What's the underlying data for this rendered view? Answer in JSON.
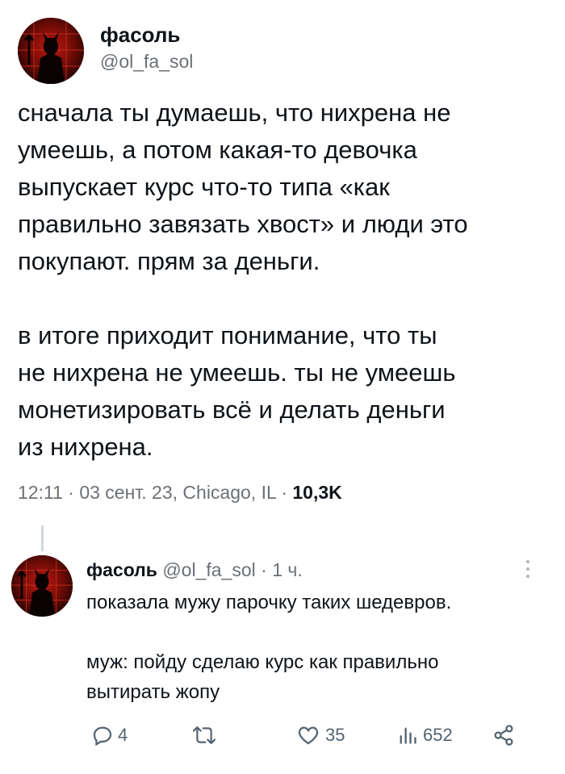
{
  "main_tweet": {
    "author_name": "фасоль",
    "author_handle": "@ol_fa_sol",
    "paragraphs": [
      "сначала ты думаешь, что нихрена не\nумеешь, а потом какая-то девочка\nвыпускает курс что-то типа «как\nправильно завязать хвост» и люди это\nпокупают. прям за деньги.",
      "в итоге приходит понимание, что ты\nне нихрена не умеешь. ты не умеешь\nмонетизировать всё и делать деньги\nиз нихрена."
    ],
    "time": "12:11",
    "date": "03 сент. 23",
    "location": "Chicago, IL",
    "separator": "·",
    "views": "10,3K"
  },
  "reply": {
    "author_name": "фасоль",
    "author_handle": "@ol_fa_sol",
    "separator": "·",
    "time_ago": "1 ч.",
    "paragraphs": [
      "показала мужу парочку таких шедевров.",
      "муж: пойду сделаю курс как правильно\nвытирать жопу"
    ],
    "actions": {
      "replies": "4",
      "retweets": "",
      "likes": "35",
      "views": "652"
    }
  },
  "icons": {
    "avatar": "devil-avatar",
    "reply": "comment-icon",
    "retweet": "retweet-icon",
    "like": "heart-icon",
    "views": "analytics-icon",
    "share": "share-icon",
    "more": "more-vertical-icon"
  },
  "colors": {
    "text": "#0f1419",
    "muted": "#6b7076",
    "thread_line": "#cfd9de"
  }
}
